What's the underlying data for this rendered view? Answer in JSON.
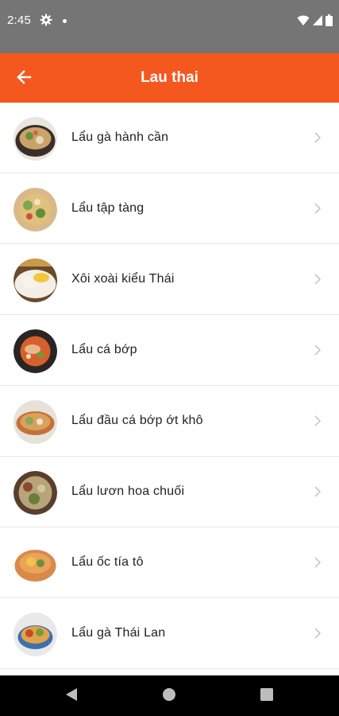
{
  "status_bar": {
    "time": "2:45",
    "icons": [
      "gear-icon",
      "notification-dot-icon",
      "wifi-icon",
      "cellular-signal-icon",
      "battery-icon"
    ]
  },
  "app_bar": {
    "title": "Lau thai",
    "back_icon": "arrow-left-icon",
    "background": "#f4581f"
  },
  "list": {
    "items": [
      {
        "label": "Lẩu gà hành cần",
        "thumb_colors": [
          "#3a2e28",
          "#c9a36a",
          "#6a8f3a"
        ]
      },
      {
        "label": "Lẩu tập tàng",
        "thumb_colors": [
          "#d9b98a",
          "#7ea64e",
          "#e0c07a"
        ]
      },
      {
        "label": "Xôi xoài kiểu Thái",
        "thumb_colors": [
          "#f3efe6",
          "#f4c63a",
          "#6b4a2a"
        ]
      },
      {
        "label": "Lẩu cá bớp",
        "thumb_colors": [
          "#2a2522",
          "#d4602e",
          "#e8b78a"
        ]
      },
      {
        "label": "Lẩu đầu cá bớp ớt khô",
        "thumb_colors": [
          "#e6e2da",
          "#8aa65a",
          "#c4703a"
        ]
      },
      {
        "label": "Lẩu lươn hoa chuối",
        "thumb_colors": [
          "#5a3e2c",
          "#b7a47a",
          "#8a4a2e"
        ]
      },
      {
        "label": "Lẩu ốc tía tô",
        "thumb_colors": [
          "#d9894a",
          "#f0c24a",
          "#6e8f3e"
        ]
      },
      {
        "label": "Lẩu gà Thái Lan",
        "thumb_colors": [
          "#e9e9ea",
          "#e0a54a",
          "#3e6fae"
        ]
      }
    ]
  },
  "nav_bar": {
    "icons": [
      "nav-back-icon",
      "nav-home-icon",
      "nav-recents-icon"
    ]
  }
}
